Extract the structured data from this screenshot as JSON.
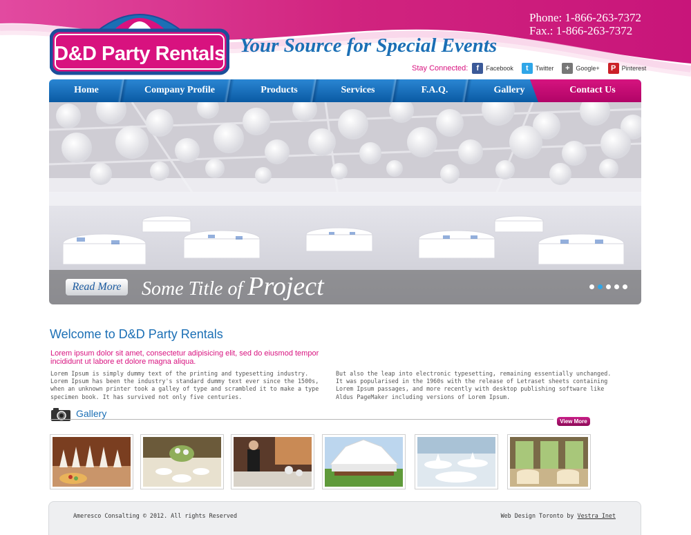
{
  "header": {
    "phone": "Phone: 1-866-263-7372",
    "fax": "Fax.: 1-866-263-7372",
    "logo_text": "D&D Party Rentals",
    "tagline": "Your Source for Special Events",
    "stay_connected": "Stay Connected:",
    "social": [
      {
        "label": "Facebook",
        "icon": "facebook-icon",
        "color": "#3b5998"
      },
      {
        "label": "Twitter",
        "icon": "twitter-icon",
        "color": "#2fa6e8"
      },
      {
        "label": "Google+",
        "icon": "google-plus-icon",
        "color": "#777777"
      },
      {
        "label": "Pinterest",
        "icon": "pinterest-icon",
        "color": "#cb2027"
      }
    ]
  },
  "nav": {
    "items": [
      "Home",
      "Company Profile",
      "Products",
      "Services",
      "F.A.Q.",
      "Gallery",
      "Contact Us"
    ],
    "active_color": "#c40c74",
    "base_color": "#1470c0"
  },
  "hero": {
    "read_more": "Read More",
    "title_prefix": "Some Title of",
    "title_main": "Project",
    "slide_count": 5,
    "active_slide": 2
  },
  "welcome": {
    "title": "Welcome to D&D Party Rentals",
    "lead": "Lorem ipsum dolor sit amet, consectetur adipisicing elit, sed do eiusmod tempor incididunt ut labore et dolore magna aliqua.",
    "para_left": "Lorem Ipsum is simply dummy text of the printing and typesetting industry. Lorem Ipsum has been the industry's standard dummy text ever since the 1500s, when an unknown printer took a galley of type and scrambled it to make a type specimen book. It has survived not only five centuries.",
    "para_right": "But also the leap into electronic typesetting, remaining essentially unchanged. It was popularised in the 1960s with the release of Letraset sheets containing Lorem Ipsum passages, and more recently with desktop publishing software like Aldus PageMaker including versions of Lorem Ipsum."
  },
  "gallery": {
    "title": "Gallery",
    "view_more": "View More",
    "thumbs": [
      "gallery-photo-buffet",
      "gallery-photo-table-setting",
      "gallery-photo-waiter",
      "gallery-photo-tent",
      "gallery-photo-banquet",
      "gallery-photo-hall"
    ]
  },
  "footer": {
    "copyright": "Ameresco Consalting © 2012. All rights Reserved",
    "credit_prefix": "Web Design Toronto by",
    "credit_link": "Vestra Inet"
  }
}
